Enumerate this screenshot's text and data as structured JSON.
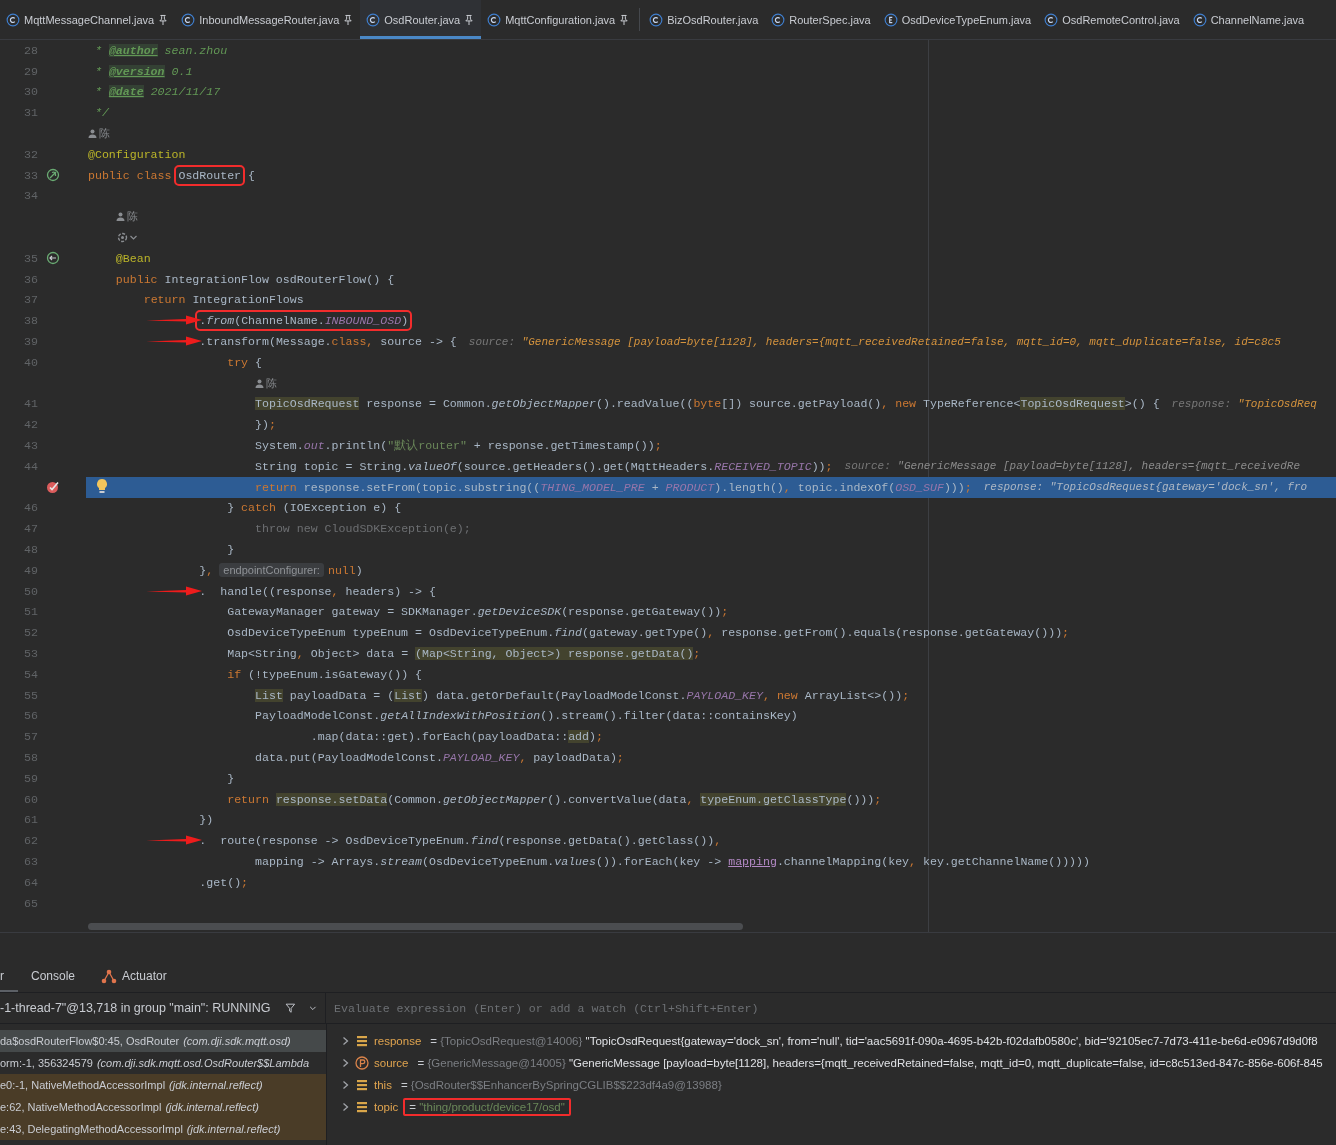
{
  "tabs": [
    {
      "label": "MqttMessageChannel.java",
      "kind": "class",
      "pinned": true,
      "selected": false
    },
    {
      "label": "InboundMessageRouter.java",
      "kind": "class",
      "pinned": true,
      "selected": false
    },
    {
      "label": "OsdRouter.java",
      "kind": "class",
      "pinned": true,
      "selected": true
    },
    {
      "label": "MqttConfiguration.java",
      "kind": "class",
      "pinned": true,
      "selected": false
    },
    {
      "label": "BizOsdRouter.java",
      "kind": "class",
      "pinned": false,
      "selected": false
    },
    {
      "label": "RouterSpec.java",
      "kind": "class",
      "pinned": false,
      "selected": false
    },
    {
      "label": "OsdDeviceTypeEnum.java",
      "kind": "enum",
      "pinned": false,
      "selected": false
    },
    {
      "label": "OsdRemoteControl.java",
      "kind": "class",
      "pinned": false,
      "selected": false
    },
    {
      "label": "ChannelName.java",
      "kind": "class",
      "pinned": false,
      "selected": false
    }
  ],
  "code": {
    "lines": [
      {
        "number": "28",
        "arrow": false,
        "current": false,
        "segments": [
          {
            "text": " * ",
            "kind": "comment"
          },
          {
            "text": "@author",
            "kind": "doctag"
          },
          {
            "text": " sean.zhou",
            "kind": "comment"
          }
        ]
      },
      {
        "number": "29",
        "arrow": false,
        "current": false,
        "segments": [
          {
            "text": " * ",
            "kind": "comment"
          },
          {
            "text": "@version",
            "kind": "doctag"
          },
          {
            "text": " 0.1",
            "kind": "comment"
          }
        ]
      },
      {
        "number": "30",
        "arrow": false,
        "current": false,
        "segments": [
          {
            "text": " * ",
            "kind": "comment"
          },
          {
            "text": "@date",
            "kind": "doctag"
          },
          {
            "text": " 2021/11/17",
            "kind": "comment"
          }
        ]
      },
      {
        "number": "31",
        "arrow": false,
        "current": false,
        "segments": [
          {
            "text": " */",
            "kind": "comment"
          }
        ]
      },
      {
        "number": "32",
        "author": {
          "name": "陈",
          "menu": false
        },
        "arrow": false,
        "current": false,
        "segments": [
          {
            "text": "@Configuration",
            "kind": "ann"
          }
        ]
      },
      {
        "number": "33",
        "kind": "bean",
        "arrow": false,
        "current": false,
        "segments": [
          {
            "text": "public class ",
            "kind": "kw"
          },
          {
            "kind": "box",
            "parts": [
              {
                "text": "OsdRouter",
                "kind": "plain"
              }
            ]
          },
          {
            "text": " {",
            "kind": "plain"
          }
        ]
      },
      {
        "number": "34",
        "arrow": false,
        "current": false
      },
      {
        "number": "35",
        "author": {
          "name": "陈",
          "menu": true
        },
        "kind": "bean_method",
        "arrow": false,
        "current": false,
        "segments": [
          {
            "text": "    @Bean",
            "kind": "ann"
          }
        ]
      },
      {
        "number": "36",
        "arrow": false,
        "current": false,
        "segments": [
          {
            "text": "    public ",
            "kind": "kw"
          },
          {
            "text": "IntegrationFlow osdRouterFlow() {",
            "kind": "plain"
          }
        ]
      },
      {
        "number": "37",
        "arrow": false,
        "current": false,
        "segments": [
          {
            "text": "        return ",
            "kind": "kw"
          },
          {
            "text": "IntegrationFlows",
            "kind": "plain"
          }
        ]
      },
      {
        "number": "38",
        "arrow": true,
        "current": false,
        "segments": [
          {
            "kind": "box",
            "parts": [
              {
                "text": "                .",
                "kind": "plain"
              },
              {
                "text": "from",
                "kind": "ital"
              },
              {
                "text": "(ChannelName.",
                "kind": "plain"
              },
              {
                "text": "INBOUND_OSD",
                "kind": "const"
              },
              {
                "text": ")",
                "kind": "plain"
              }
            ]
          }
        ]
      },
      {
        "number": "39",
        "arrow": true,
        "current": false,
        "segments": [
          {
            "text": "                .transform(Message.",
            "kind": "plain"
          },
          {
            "text": "class,",
            "kind": "kw"
          },
          {
            "text": " source -> {",
            "kind": "plain"
          },
          {
            "text": "source: ",
            "kind": "hintlabel"
          },
          {
            "text": "\"GenericMessage [payload=byte[1128], headers={mqtt_receivedRetained=false, mqtt_id=0, mqtt_duplicate=false, id=c8c5",
            "kind": "hintval"
          }
        ]
      },
      {
        "number": "40",
        "arrow": false,
        "current": false,
        "segments": [
          {
            "text": "                    try",
            "kind": "kw"
          },
          {
            "text": " {",
            "kind": "plain"
          }
        ]
      },
      {
        "number": "41",
        "author": {
          "name": "陈",
          "menu": false
        },
        "arrow": false,
        "current": false,
        "segments": [
          {
            "text": "                        TopicOsdRequest",
            "kind": "hl"
          },
          {
            "text": " response = Common.",
            "kind": "plain"
          },
          {
            "text": "getObjectMapper",
            "kind": "ital"
          },
          {
            "text": "().readValue((",
            "kind": "plain"
          },
          {
            "text": "byte",
            "kind": "kw"
          },
          {
            "text": "[]) source.getPayload()",
            "kind": "plain"
          },
          {
            "text": ", new",
            "kind": "kw"
          },
          {
            "text": " TypeReference<",
            "kind": "plain"
          },
          {
            "text": "TopicOsdRequest",
            "kind": "hl"
          },
          {
            "text": ">() {",
            "kind": "plain"
          },
          {
            "text": "response: ",
            "kind": "hintlabel"
          },
          {
            "text": "\"TopicOsdReq",
            "kind": "hintval"
          }
        ]
      },
      {
        "number": "42",
        "arrow": false,
        "current": false,
        "segments": [
          {
            "text": "                        })",
            "kind": "plain"
          },
          {
            "text": ";",
            "kind": "kw"
          }
        ]
      },
      {
        "number": "43",
        "arrow": false,
        "current": false,
        "segments": [
          {
            "text": "                        System.",
            "kind": "plain"
          },
          {
            "text": "out",
            "kind": "const"
          },
          {
            "text": ".println(",
            "kind": "plain"
          },
          {
            "text": "\"默认router\"",
            "kind": "str"
          },
          {
            "text": " + response.getTimestamp())",
            "kind": "plain"
          },
          {
            "text": ";",
            "kind": "kw"
          }
        ]
      },
      {
        "number": "44",
        "arrow": false,
        "current": false,
        "segments": [
          {
            "text": "                        String topic = String.",
            "kind": "plain"
          },
          {
            "text": "valueOf",
            "kind": "ital"
          },
          {
            "text": "(source.getHeaders().get(MqttHeaders.",
            "kind": "plain"
          },
          {
            "text": "RECEIVED_TOPIC",
            "kind": "const"
          },
          {
            "text": "))",
            "kind": "plain"
          },
          {
            "text": ";",
            "kind": "kw"
          },
          {
            "text": "source: ",
            "kind": "hintlabel"
          },
          {
            "text": "\"GenericMessage [payload=byte[1128], headers={mqtt_receivedRe",
            "kind": "hintgrey"
          }
        ]
      },
      {
        "kind": "breakpoint",
        "arrow": false,
        "current": true,
        "segments": [
          {
            "text": "                        return",
            "kind": "kw"
          },
          {
            "text": " response.setFrom(topic.substring((",
            "kind": "plain"
          },
          {
            "text": "THING_MODEL_PRE",
            "kind": "const"
          },
          {
            "text": " + ",
            "kind": "plain"
          },
          {
            "text": "PRODUCT",
            "kind": "const"
          },
          {
            "text": ").length()",
            "kind": "plain"
          },
          {
            "text": ",",
            "kind": "kw"
          },
          {
            "text": " topic.indexOf(",
            "kind": "plain"
          },
          {
            "text": "OSD_SUF",
            "kind": "const"
          },
          {
            "text": ")))",
            "kind": "plain"
          },
          {
            "text": ";",
            "kind": "kw"
          },
          {
            "text": "response: ",
            "kind": "hintlabel"
          },
          {
            "text": "\"TopicOsdRequest{gateway='dock_sn', fro",
            "kind": "hintgrey"
          }
        ]
      },
      {
        "number": "46",
        "arrow": false,
        "current": false,
        "segments": [
          {
            "text": "                    } ",
            "kind": "plain"
          },
          {
            "text": "catch",
            "kind": "kw"
          },
          {
            "text": " (IOException e) {",
            "kind": "plain"
          }
        ]
      },
      {
        "number": "47",
        "arrow": false,
        "current": false,
        "segments": [
          {
            "text": "                        throw new CloudSDKException(e);",
            "kind": "dim"
          }
        ]
      },
      {
        "number": "48",
        "arrow": false,
        "current": false,
        "segments": [
          {
            "text": "                    }",
            "kind": "plain"
          }
        ]
      },
      {
        "number": "49",
        "arrow": false,
        "current": false,
        "segments": [
          {
            "text": "                }",
            "kind": "plain"
          },
          {
            "text": ",",
            "kind": "kw"
          },
          {
            "text": "endpointConfigurer:",
            "kind": "chip"
          },
          {
            "text": "null",
            "kind": "kw"
          },
          {
            "text": ")",
            "kind": "plain"
          }
        ]
      },
      {
        "number": "50",
        "arrow": true,
        "current": false,
        "segments": [
          {
            "text": "                .  handle((response",
            "kind": "plain"
          },
          {
            "text": ",",
            "kind": "kw"
          },
          {
            "text": " headers) -> {",
            "kind": "plain"
          }
        ]
      },
      {
        "number": "51",
        "arrow": false,
        "current": false,
        "segments": [
          {
            "text": "                    GatewayManager gateway = SDKManager.",
            "kind": "plain"
          },
          {
            "text": "getDeviceSDK",
            "kind": "ital"
          },
          {
            "text": "(response.getGateway())",
            "kind": "plain"
          },
          {
            "text": ";",
            "kind": "kw"
          }
        ]
      },
      {
        "number": "52",
        "arrow": false,
        "current": false,
        "segments": [
          {
            "text": "                    OsdDeviceTypeEnum typeEnum = OsdDeviceTypeEnum.",
            "kind": "plain"
          },
          {
            "text": "find",
            "kind": "ital"
          },
          {
            "text": "(gateway.getType()",
            "kind": "plain"
          },
          {
            "text": ",",
            "kind": "kw"
          },
          {
            "text": " response.getFrom().equals(response.getGateway()))",
            "kind": "plain"
          },
          {
            "text": ";",
            "kind": "kw"
          }
        ]
      },
      {
        "number": "53",
        "arrow": false,
        "current": false,
        "segments": [
          {
            "text": "                    Map<String",
            "kind": "plain"
          },
          {
            "text": ",",
            "kind": "kw"
          },
          {
            "text": " Object> data = ",
            "kind": "plain"
          },
          {
            "text": "(Map<String, Object>) response.getData()",
            "kind": "hl"
          },
          {
            "text": ";",
            "kind": "kw"
          }
        ]
      },
      {
        "number": "54",
        "arrow": false,
        "current": false,
        "segments": [
          {
            "text": "                    if",
            "kind": "kw"
          },
          {
            "text": " (!typeEnum.isGateway()) {",
            "kind": "plain"
          }
        ]
      },
      {
        "number": "55",
        "arrow": false,
        "current": false,
        "segments": [
          {
            "text": "                        List",
            "kind": "hl"
          },
          {
            "text": " payloadData = (",
            "kind": "plain"
          },
          {
            "text": "List",
            "kind": "hl"
          },
          {
            "text": ") data.getOrDefault(PayloadModelConst.",
            "kind": "plain"
          },
          {
            "text": "PAYLOAD_KEY",
            "kind": "const"
          },
          {
            "text": ", new",
            "kind": "kw"
          },
          {
            "text": " ArrayList<>())",
            "kind": "plain"
          },
          {
            "text": ";",
            "kind": "kw"
          }
        ]
      },
      {
        "number": "56",
        "arrow": false,
        "current": false,
        "segments": [
          {
            "text": "                        PayloadModelConst.",
            "kind": "plain"
          },
          {
            "text": "getAllIndexWithPosition",
            "kind": "ital"
          },
          {
            "text": "().stream().filter(data::containsKey)",
            "kind": "plain"
          }
        ]
      },
      {
        "number": "57",
        "arrow": false,
        "current": false,
        "segments": [
          {
            "text": "                                .map(data::get).forEach(payloadData::",
            "kind": "plain"
          },
          {
            "text": "add",
            "kind": "hl"
          },
          {
            "text": ")",
            "kind": "plain"
          },
          {
            "text": ";",
            "kind": "kw"
          }
        ]
      },
      {
        "number": "58",
        "arrow": false,
        "current": false,
        "segments": [
          {
            "text": "                        data.put(PayloadModelConst.",
            "kind": "plain"
          },
          {
            "text": "PAYLOAD_KEY",
            "kind": "const"
          },
          {
            "text": ",",
            "kind": "kw"
          },
          {
            "text": " payloadData)",
            "kind": "plain"
          },
          {
            "text": ";",
            "kind": "kw"
          }
        ]
      },
      {
        "number": "59",
        "arrow": false,
        "current": false,
        "segments": [
          {
            "text": "                    }",
            "kind": "plain"
          }
        ]
      },
      {
        "number": "60",
        "arrow": false,
        "current": false,
        "segments": [
          {
            "text": "                    return ",
            "kind": "kw"
          },
          {
            "text": "response.setData",
            "kind": "hl"
          },
          {
            "text": "(Common.",
            "kind": "plain"
          },
          {
            "text": "getObjectMapper",
            "kind": "ital"
          },
          {
            "text": "().convertValue(data",
            "kind": "plain"
          },
          {
            "text": ", ",
            "kind": "kw"
          },
          {
            "text": "typeEnum.getClassType",
            "kind": "hl"
          },
          {
            "text": "()))",
            "kind": "plain"
          },
          {
            "text": ";",
            "kind": "kw"
          }
        ]
      },
      {
        "number": "61",
        "arrow": false,
        "current": false,
        "segments": [
          {
            "text": "                })",
            "kind": "plain"
          }
        ]
      },
      {
        "number": "62",
        "arrow": true,
        "current": false,
        "segments": [
          {
            "text": "                .  route(response -> OsdDeviceTypeEnum.",
            "kind": "plain"
          },
          {
            "text": "find",
            "kind": "ital"
          },
          {
            "text": "(response.getData().getClass())",
            "kind": "plain"
          },
          {
            "text": ",",
            "kind": "kw"
          }
        ]
      },
      {
        "number": "63",
        "arrow": false,
        "current": false,
        "segments": [
          {
            "text": "                        mapping -> Arrays.",
            "kind": "plain"
          },
          {
            "text": "stream",
            "kind": "ital"
          },
          {
            "text": "(OsdDeviceTypeEnum.",
            "kind": "plain"
          },
          {
            "text": "values",
            "kind": "ital"
          },
          {
            "text": "()).forEach(key -> ",
            "kind": "plain"
          },
          {
            "text": "mapping",
            "kind": "link"
          },
          {
            "text": ".channelMapping(key",
            "kind": "plain"
          },
          {
            "text": ",",
            "kind": "kw"
          },
          {
            "text": " key.getChannelName()))))",
            "kind": "plain"
          }
        ]
      },
      {
        "number": "64",
        "arrow": false,
        "current": false,
        "segments": [
          {
            "text": "                .get()",
            "kind": "plain"
          },
          {
            "text": ";",
            "kind": "kw"
          }
        ]
      },
      {
        "number": "65",
        "arrow": false,
        "current": false
      }
    ]
  },
  "debug": {
    "tabs": [
      {
        "label": "r",
        "selected": true,
        "kind": "text"
      },
      {
        "label": "Console",
        "selected": false,
        "kind": "text"
      },
      {
        "label": "Actuator",
        "selected": false,
        "kind": "actuator"
      }
    ],
    "thread": "-1-thread-7\"@13,718 in group \"main\": RUNNING",
    "evaluate": {
      "placeholder": "Evaluate expression (Enter) or add a watch (Ctrl+Shift+Enter)"
    },
    "frames": [
      {
        "method": "da$osdRouterFlow$0:45, OsdRouter",
        "package": "(com.dji.sdk.mqtt.osd)",
        "selected": true,
        "library": false
      },
      {
        "method": "orm:-1, 356324579",
        "package": "(com.dji.sdk.mqtt.osd.OsdRouter$$Lambda",
        "selected": false,
        "library": false
      },
      {
        "method": "e0:-1, NativeMethodAccessorImpl",
        "package": "(jdk.internal.reflect)",
        "selected": false,
        "library": true
      },
      {
        "method": "e:62, NativeMethodAccessorImpl",
        "package": "(jdk.internal.reflect)",
        "selected": false,
        "library": true
      },
      {
        "method": "e:43, DelegatingMethodAccessorImpl",
        "package": "(jdk.internal.reflect)",
        "selected": false,
        "library": true
      }
    ],
    "variables": [
      {
        "kind": "field",
        "name": "response",
        "operator": "=",
        "type": "{TopicOsdRequest@14006}",
        "value": {
          "text": "\"TopicOsdRequest{gateway='dock_sn', from='null', tid='aac5691f-090a-4695-b42b-f02dafb0580c', bid='92105ec7-7d73-411e-be6d-e0967d9d0f8",
          "kind": "object"
        },
        "boxed": false
      },
      {
        "kind": "param",
        "name": "source",
        "operator": "=",
        "type": "{GenericMessage@14005}",
        "value": {
          "text": "\"GenericMessage [payload=byte[1128], headers={mqtt_receivedRetained=false, mqtt_id=0, mqtt_duplicate=false, id=c8c513ed-847c-856e-606f-845",
          "kind": "object"
        },
        "boxed": false
      },
      {
        "kind": "field",
        "name": "this",
        "operator": "=",
        "type": "{OsdRouter$$EnhancerBySpringCGLIB$$223df4a9@13988}",
        "boxed": false
      },
      {
        "kind": "field",
        "name": "topic",
        "operator": "=",
        "value": {
          "text": "\"thing/product/device17/osd\"",
          "kind": "string"
        },
        "boxed": true
      }
    ]
  }
}
